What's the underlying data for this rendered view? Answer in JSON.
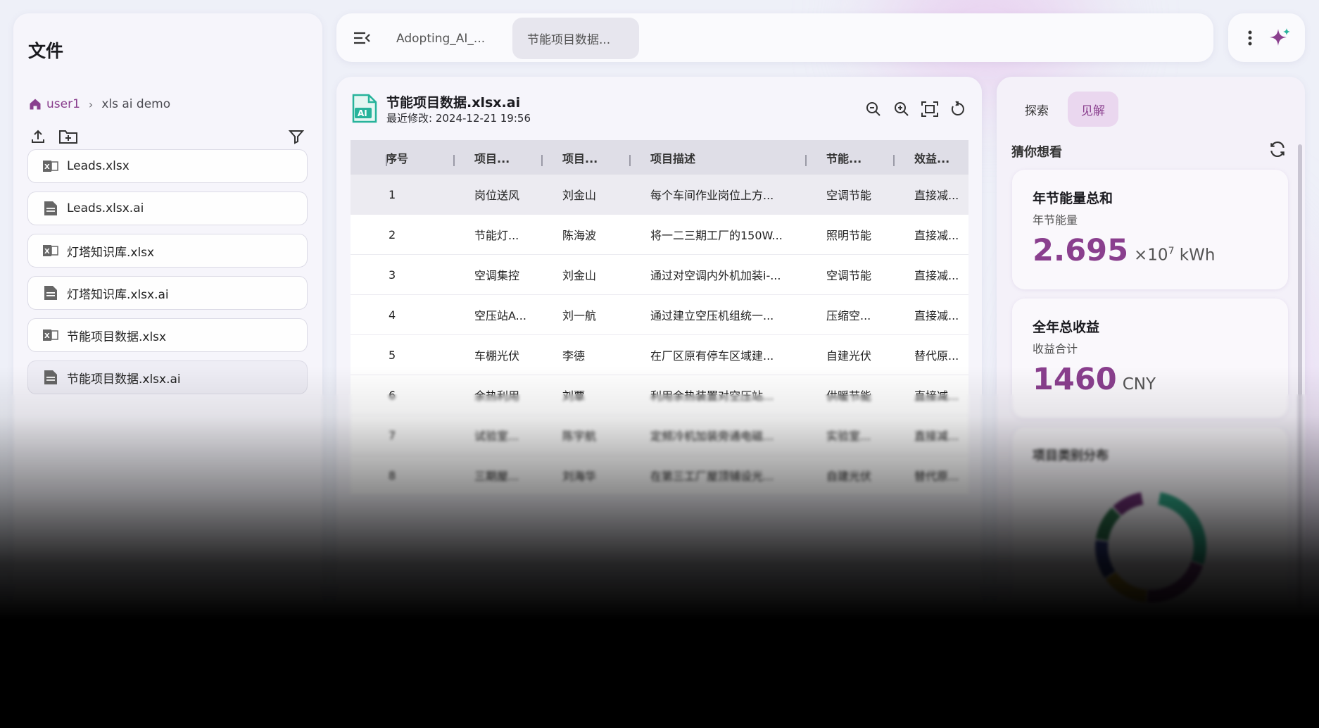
{
  "colors": {
    "accent": "#8a3f8e",
    "teal": "#27b39b"
  },
  "sidebar": {
    "title": "文件",
    "breadcrumb": {
      "root": "user1",
      "current": "xls ai demo"
    },
    "files": [
      {
        "name": "Leads.xlsx",
        "icon": "excel-file-icon"
      },
      {
        "name": "Leads.xlsx.ai",
        "icon": "document-icon"
      },
      {
        "name": "灯塔知识库.xlsx",
        "icon": "excel-file-icon"
      },
      {
        "name": "灯塔知识库.xlsx.ai",
        "icon": "document-icon"
      },
      {
        "name": "节能项目数据.xlsx",
        "icon": "excel-file-icon"
      },
      {
        "name": "节能项目数据.xlsx.ai",
        "icon": "document-icon"
      }
    ]
  },
  "tabs": [
    {
      "label": "Adopting_AI_..."
    },
    {
      "label": "节能项目数据..."
    }
  ],
  "doc": {
    "title": "节能项目数据.xlsx.ai",
    "modified": "最近修改: 2024-12-21 19:56",
    "icon_text": "AI"
  },
  "table": {
    "headers": [
      "序号",
      "项目...",
      "项目...",
      "项目描述",
      "节能...",
      "效益..."
    ],
    "rows": [
      [
        "1",
        "岗位送风",
        "刘金山",
        "每个车间作业岗位上方...",
        "空调节能",
        "直接减..."
      ],
      [
        "2",
        "节能灯...",
        "陈海波",
        "将一二三期工厂的150W...",
        "照明节能",
        "直接减..."
      ],
      [
        "3",
        "空调集控",
        "刘金山",
        "通过对空调内外机加装i-...",
        "空调节能",
        "直接减..."
      ],
      [
        "4",
        "空压站A...",
        "刘一航",
        "通过建立空压机组统一...",
        "压缩空...",
        "直接减..."
      ],
      [
        "5",
        "车棚光伏",
        "李德",
        "在厂区原有停车区域建...",
        "自建光伏",
        "替代原..."
      ],
      [
        "6",
        "余热利用",
        "刘覃",
        "利用余热装置对空压站...",
        "供暖节能",
        "直接减..."
      ],
      [
        "7",
        "试验室...",
        "陈宇航",
        "定频冷机加装旁通电磁...",
        "实验室...",
        "直接减..."
      ],
      [
        "8",
        "三期屋...",
        "刘海华",
        "在第三工厂屋顶铺设光...",
        "自建光伏",
        "替代原..."
      ]
    ]
  },
  "insights": {
    "tabs": [
      "探索",
      "见解"
    ],
    "guess_title": "猜你想看",
    "cards": [
      {
        "title": "年节能量总和",
        "subtitle": "年节能量",
        "value": "2.695",
        "unit_prefix": "×10",
        "unit_exp": "7",
        "unit": "kWh"
      },
      {
        "title": "全年总收益",
        "subtitle": "收益合计",
        "value": "1460",
        "unit": "CNY"
      }
    ],
    "distribution_title": "项目类别分布"
  }
}
